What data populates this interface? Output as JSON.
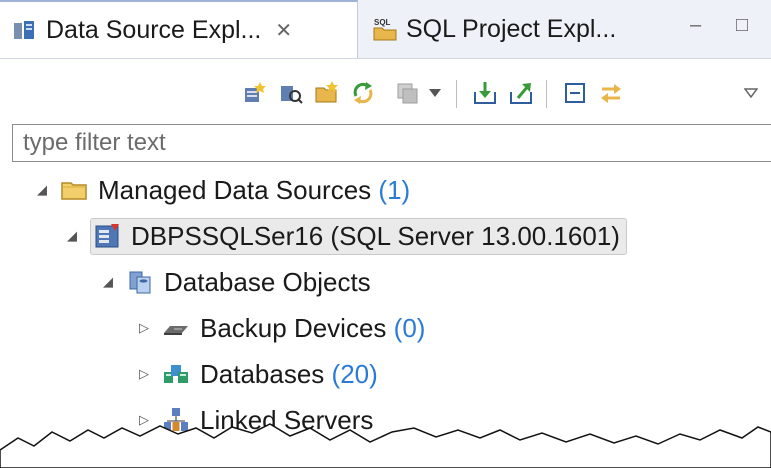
{
  "tabs": [
    {
      "label": "Data Source Expl...",
      "close": "✕"
    },
    {
      "label": "SQL Project Expl..."
    }
  ],
  "window_buttons": {
    "minimize": "–",
    "maximize": "□"
  },
  "toolbar": {
    "icons": [
      "new-connection-profile-icon",
      "new-filter-icon",
      "new-folder-icon",
      "refresh-icon",
      "copy-icon",
      "dropdown-arrow-icon",
      "import-icon",
      "export-icon",
      "collapse-all-icon",
      "link-with-editor-icon",
      "view-menu-icon"
    ]
  },
  "filter": {
    "placeholder": "type filter text"
  },
  "tree": {
    "root": {
      "label": "Managed Data Sources",
      "count": "(1)"
    },
    "server": {
      "label": "DBPSSQLSer16  (SQL Server 13.00.1601)"
    },
    "objects": {
      "label": "Database Objects"
    },
    "items": [
      {
        "label": "Backup Devices",
        "count": "(0)"
      },
      {
        "label": "Databases",
        "count": "(20)"
      },
      {
        "label": "Linked Servers",
        "count": ""
      }
    ]
  },
  "colors": {
    "count": "#2a7bd6",
    "selection": "#eaeaea",
    "folder": "#e8b64a"
  }
}
